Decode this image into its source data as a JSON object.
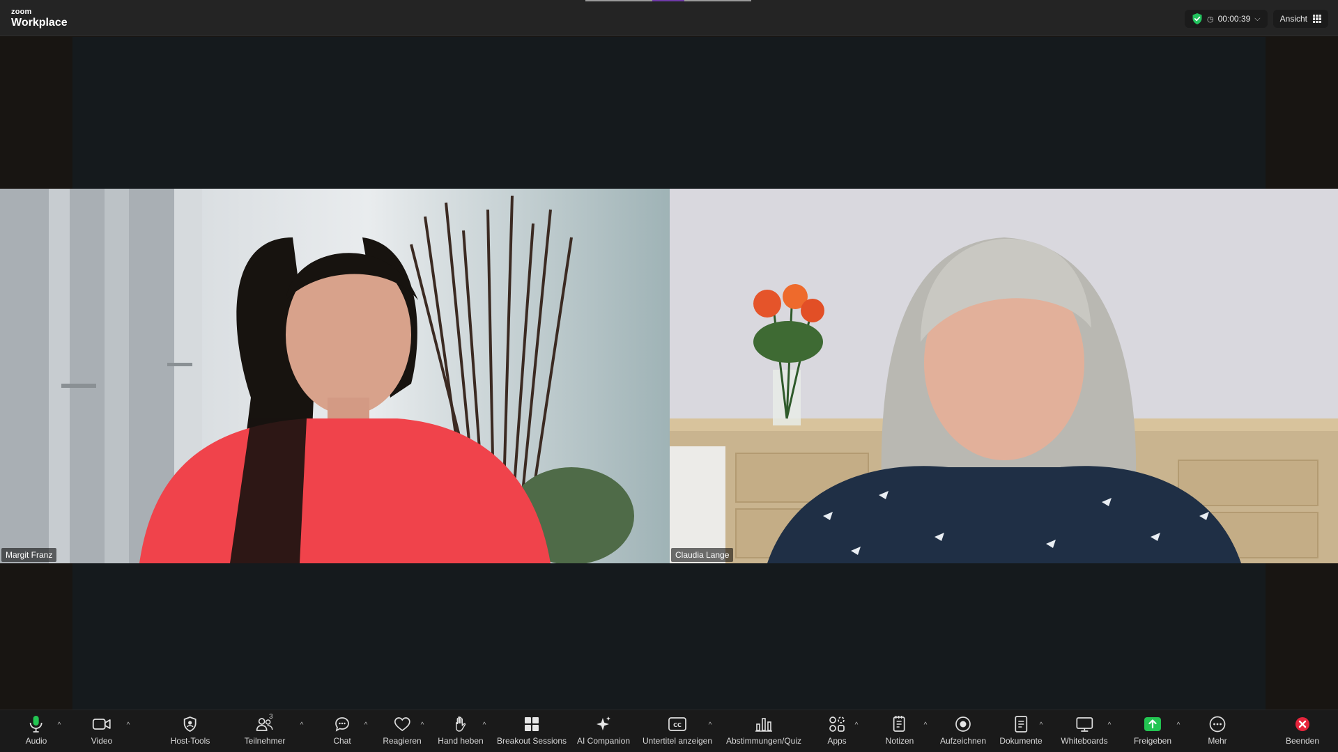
{
  "app": {
    "logo_small": "zoom",
    "logo_big": "Workplace"
  },
  "topbar": {
    "timer": "00:00:39",
    "view_label": "Ansicht"
  },
  "participants": [
    {
      "name": "Margit Franz"
    },
    {
      "name": "Claudia Lange"
    }
  ],
  "toolbar": {
    "audio": "Audio",
    "video": "Video",
    "host_tools": "Host-Tools",
    "participants": "Teilnehmer",
    "participants_count": "3",
    "chat": "Chat",
    "react": "Reagieren",
    "raise_hand": "Hand heben",
    "breakout": "Breakout Sessions",
    "ai": "AI Companion",
    "captions": "Untertitel anzeigen",
    "polls": "Abstimmungen/Quiz",
    "apps": "Apps",
    "notes": "Notizen",
    "record": "Aufzeichnen",
    "docs": "Dokumente",
    "whiteboards": "Whiteboards",
    "share": "Freigeben",
    "more": "Mehr",
    "end": "Beenden"
  },
  "colors": {
    "share_green": "#23c552",
    "end_red": "#e5253c",
    "secure_green": "#22c35e",
    "top_tab_accent": "#6f3aa8"
  }
}
